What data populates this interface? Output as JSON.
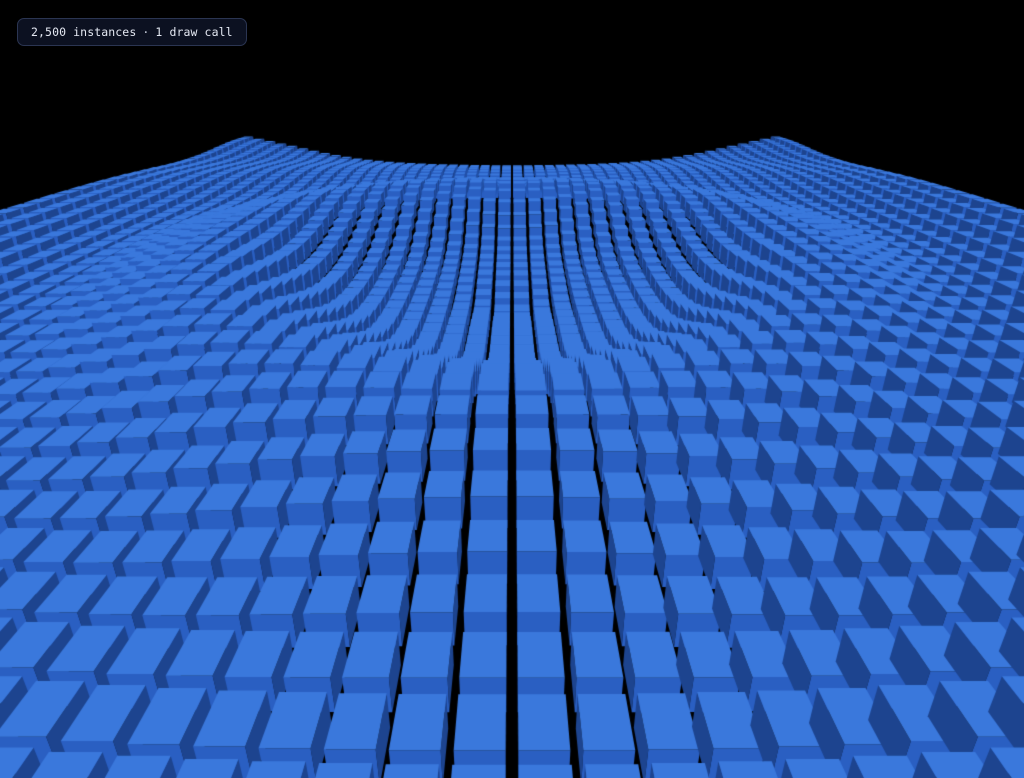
{
  "hud": {
    "instances_label": "2,500 instances",
    "separator": "·",
    "draw_calls_label": "1 draw call"
  },
  "scene": {
    "description_icon": "instanced-cube-wave-icon",
    "grid": {
      "columns": 50,
      "rows": 50
    },
    "colors": {
      "background": "#000000",
      "cube_top": "#3a78dc",
      "cube_front": "#2a5fc2",
      "cube_side": "#1d448f",
      "badge_background": "#0e1426",
      "badge_border": "#2b3552",
      "badge_text": "#e4e8f2"
    }
  }
}
